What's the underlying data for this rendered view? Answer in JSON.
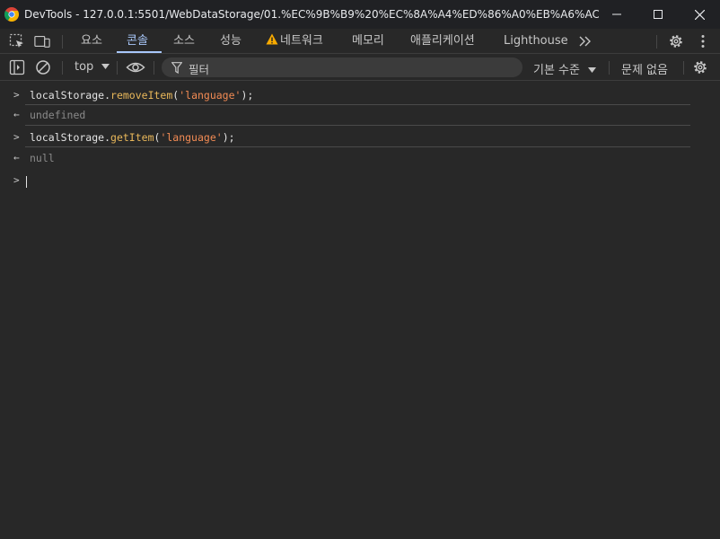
{
  "window": {
    "title": "DevTools - 127.0.0.1:5501/WebDataStorage/01.%EC%9B%B9%20%EC%8A%A4%ED%86%A0%EB%A6%AC%EC%A7%..."
  },
  "tabs": [
    {
      "label": "요소"
    },
    {
      "label": "콘솔"
    },
    {
      "label": "소스"
    },
    {
      "label": "성능"
    },
    {
      "label": "네트워크"
    },
    {
      "label": "메모리"
    },
    {
      "label": "애플리케이션"
    },
    {
      "label": "Lighthouse"
    }
  ],
  "toolbar": {
    "context": "top",
    "filter_placeholder": "필터",
    "levels": "기본 수준",
    "issues": "문제 없음"
  },
  "console": {
    "entries": [
      {
        "object": "localStorage",
        "method": "removeItem",
        "arg": "'language'",
        "end": ");"
      },
      {
        "result": "undefined"
      },
      {
        "object": "localStorage",
        "method": "getItem",
        "arg": "'language'",
        "end": ");"
      },
      {
        "result": "null"
      }
    ]
  },
  "colors": {
    "accent": "#a8c7fa",
    "method": "#e8b75a",
    "string": "#f28b54",
    "warning": "#f9ab00"
  }
}
